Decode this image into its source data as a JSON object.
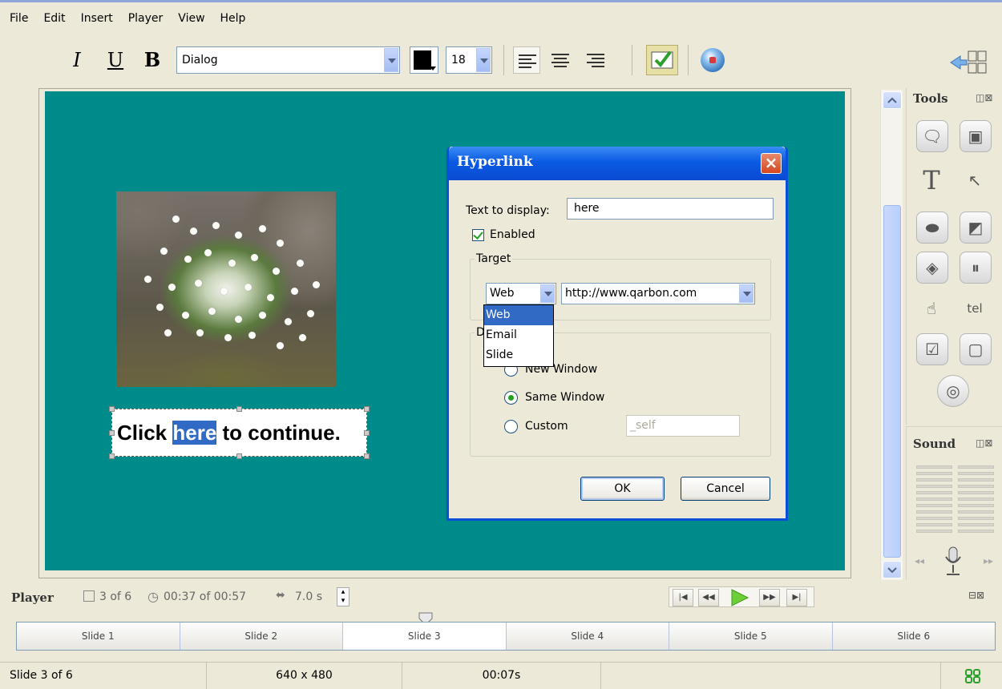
{
  "menu": [
    "File",
    "Edit",
    "Insert",
    "Player",
    "View",
    "Help"
  ],
  "toolbar": {
    "italic": "I",
    "underline": "U",
    "bold": "B",
    "font_name": "Dialog",
    "font_size": "18"
  },
  "slide": {
    "caption_before": "Click ",
    "caption_link": "here",
    "caption_after": " to continue."
  },
  "dialog": {
    "title": "Hyperlink",
    "close": "×",
    "text_to_display_label": "Text to display:",
    "text_to_display_value": "here",
    "enabled_label": "Enabled",
    "target_legend": "Target",
    "target_type": "Web",
    "target_url": "http://www.qarbon.com",
    "dropdown_options": [
      "Web",
      "Email",
      "Slide"
    ],
    "dest_legend_fragment": "D",
    "radio_new_window": "New Window",
    "radio_same_window": "Same Window",
    "radio_custom": "Custom",
    "custom_value": "_self",
    "ok": "OK",
    "cancel": "Cancel"
  },
  "panels": {
    "tools_title": "Tools",
    "sound_title": "Sound"
  },
  "player": {
    "label": "Player",
    "slide_counter": "3 of 6",
    "time": "00:37 of 00:57",
    "duration": "7.0 s"
  },
  "timeline": [
    "Slide 1",
    "Slide 2",
    "Slide 3",
    "Slide 4",
    "Slide 5",
    "Slide 6"
  ],
  "status": {
    "slide": "Slide 3 of 6",
    "size": "640 x 480",
    "time": "00:07s"
  }
}
